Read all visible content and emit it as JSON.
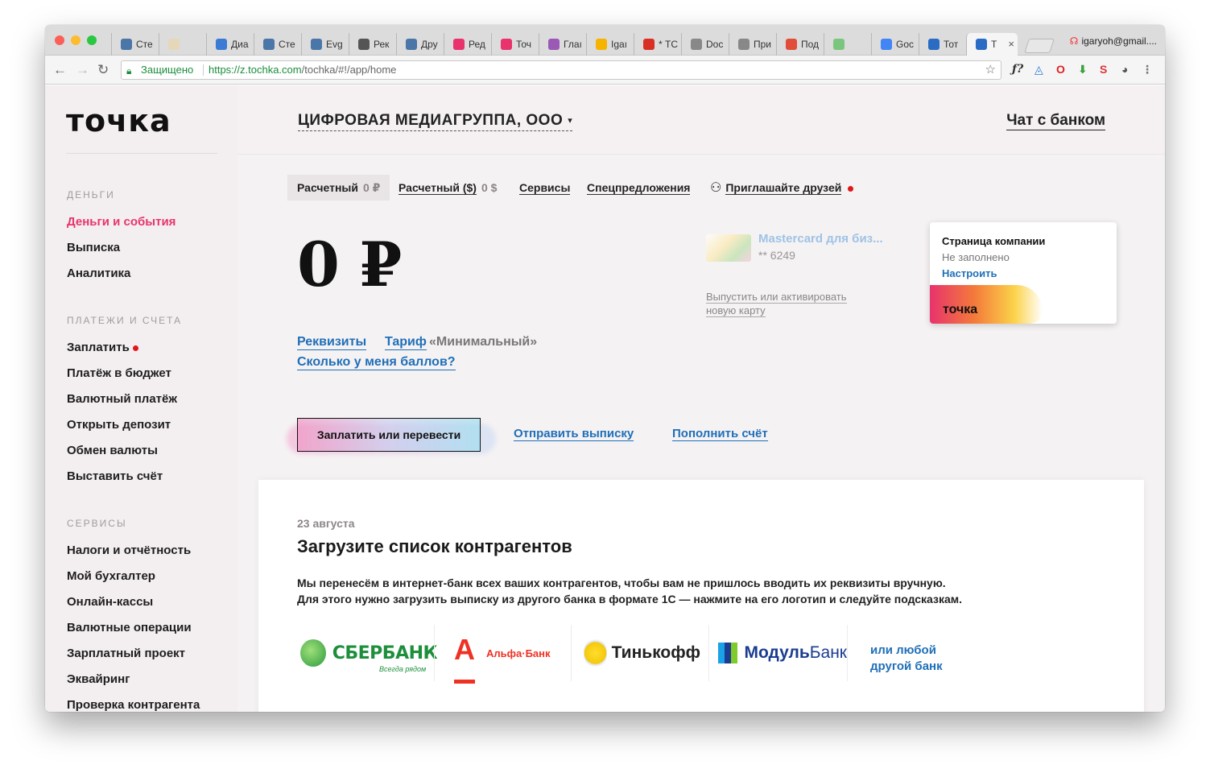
{
  "browser": {
    "tabs": [
      {
        "label": "Сте",
        "fav": "vk-icon",
        "color": "#4a76a8"
      },
      {
        "label": "",
        "fav": "blank-tab-icon",
        "color": "#e5d7b8"
      },
      {
        "label": "Диа",
        "fav": "chat-icon",
        "color": "#3b7bd4"
      },
      {
        "label": "Сте",
        "fav": "vk-icon",
        "color": "#4a76a8"
      },
      {
        "label": "Evg",
        "fav": "vk-icon",
        "color": "#4a76a8"
      },
      {
        "label": "Рек",
        "fav": "t-circle-icon",
        "color": "#555555"
      },
      {
        "label": "Дру",
        "fav": "vk-icon",
        "color": "#4a76a8"
      },
      {
        "label": "Ред",
        "fav": "pink-i-icon",
        "color": "#e8336c"
      },
      {
        "label": "Точ",
        "fav": "pink-i-icon",
        "color": "#e8336c"
      },
      {
        "label": "Глаı",
        "fav": "eye-icon",
        "color": "#9b59b6"
      },
      {
        "label": "Igaı",
        "fav": "bars-icon",
        "color": "#f4b400"
      },
      {
        "label": "* ТС",
        "fav": "mail-icon",
        "color": "#d93025"
      },
      {
        "label": "Doc",
        "fav": "doc-icon",
        "color": "#888888"
      },
      {
        "label": "При",
        "fav": "doc-icon",
        "color": "#888888"
      },
      {
        "label": "Под",
        "fav": "chart-icon",
        "color": "#e04e39"
      },
      {
        "label": "",
        "fav": "green-tab-icon",
        "color": "#7bc67e"
      },
      {
        "label": "Goc",
        "fav": "ads-icon",
        "color": "#4285f4"
      },
      {
        "label": "Тот",
        "fav": "t-icon",
        "color": "#2a6cc4"
      },
      {
        "label": "Т",
        "fav": "t-icon",
        "color": "#2a6cc4"
      }
    ],
    "close_glyph": "×",
    "user_email": "igaryoh@gmail....",
    "nav": {
      "back": "←",
      "forward": "→",
      "reload": "↻"
    },
    "omnibox": {
      "secure_label": "Защищено",
      "url_host": "https://z.tochka.com",
      "url_path": "/tochka/#!/app/home"
    }
  },
  "sidebar": {
    "logo": "точка",
    "sections": [
      {
        "title": "ДЕНЬГИ",
        "items": [
          {
            "label": "Деньги и события",
            "active": true
          },
          {
            "label": "Выписка"
          },
          {
            "label": "Аналитика"
          }
        ]
      },
      {
        "title": "ПЛАТЕЖИ И СЧЕТА",
        "items": [
          {
            "label": "Заплатить",
            "dot": true
          },
          {
            "label": "Платёж в бюджет"
          },
          {
            "label": "Валютный платёж"
          },
          {
            "label": "Открыть депозит"
          },
          {
            "label": "Обмен валюты"
          },
          {
            "label": "Выставить счёт"
          }
        ]
      },
      {
        "title": "СЕРВИСЫ",
        "items": [
          {
            "label": "Налоги и отчётность"
          },
          {
            "label": "Мой бухгалтер"
          },
          {
            "label": "Онлайн-кассы"
          },
          {
            "label": "Валютные операции"
          },
          {
            "label": "Зарплатный проект"
          },
          {
            "label": "Эквайринг"
          },
          {
            "label": "Проверка контрагента"
          }
        ]
      }
    ]
  },
  "header": {
    "company": "ЦИФРОВАЯ МЕДИАГРУППА, ООО",
    "chat": "Чат с банком"
  },
  "account_tabs": [
    {
      "label": "Расчетный",
      "amount": "0 ₽",
      "selected": true
    },
    {
      "label": "Расчетный ($)",
      "amount": "0 $"
    },
    {
      "label": "Сервисы"
    },
    {
      "label": "Спецпредложения"
    },
    {
      "label": "Приглашайте друзей",
      "icon": "add-user-icon",
      "dot": true
    }
  ],
  "balance": "0 ₽",
  "links": {
    "requisites": "Реквизиты",
    "tariff": "Тариф",
    "tariff_name": "«Минимальный»",
    "points": "Сколько у меня баллов?"
  },
  "card": {
    "name": "Mastercard для биз...",
    "number": "** 6249",
    "issue_link": "Выпустить или активировать новую карту"
  },
  "company_page": {
    "title": "Страница компании",
    "status": "Не заполнено",
    "action": "Настроить",
    "logo_text": "точка"
  },
  "actions": {
    "pay": "Заплатить или перевести",
    "send_statement": "Отправить выписку",
    "top_up": "Пополнить счёт"
  },
  "news": {
    "date": "23 августа",
    "title": "Загрузите список контрагентов",
    "body_line1": "Мы перенесём в интернет-банк всех ваших контрагентов, чтобы вам не пришлось вводить их реквизиты вручную.",
    "body_line2": "Для этого нужно загрузить выписку из другого банка в формате 1С — нажмите на его логотип и следуйте подсказкам.",
    "banks": {
      "sber": "СБЕРБАНК",
      "sber_tagline": "Всегда рядом",
      "alfa_letter": "А",
      "alfa": "Альфа·Банк",
      "tinkoff": "Тинькофф",
      "modul_a": "Модуль",
      "modul_b": "Банк",
      "other": "или любой другой банк"
    }
  },
  "colors": {
    "accent_pink": "#e8356d",
    "link_blue": "#1f6fb8",
    "red_dot": "#e0161b"
  }
}
